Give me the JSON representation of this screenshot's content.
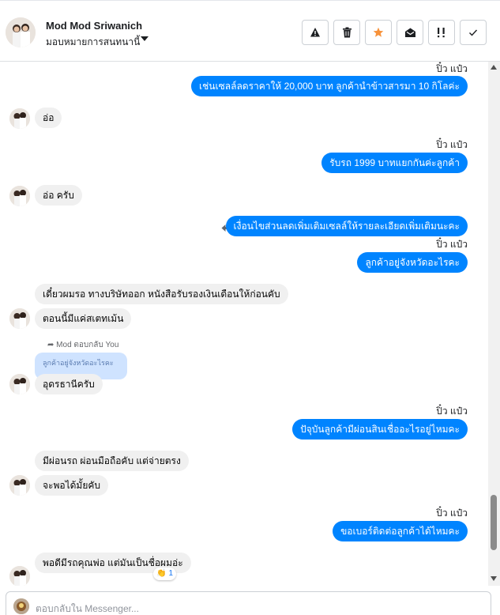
{
  "header": {
    "contact_name": "Mod Mod Sriwanich",
    "assign_label": "มอบหมายการสนทนานี้",
    "tools": [
      {
        "icon": "warning-icon"
      },
      {
        "icon": "trash-icon"
      },
      {
        "icon": "star-icon",
        "color": "#f7923a"
      },
      {
        "icon": "mark-unread-icon"
      },
      {
        "icon": "follow-up-icon"
      },
      {
        "icon": "check-icon"
      }
    ]
  },
  "messages": {
    "m1": {
      "sender": "ปิ๋ว แป๋ว",
      "text": "เช่นเซลล์ลดราคาให้ 20,000 บาท ลูกค้านำข้าวสารมา 10 กิโลค่ะ"
    },
    "m2": {
      "text": "อ่อ"
    },
    "m3": {
      "sender": "ปิ๋ว แป๋ว",
      "text": "รับรถ 1999 บาทแยกกันค่ะลูกค้า"
    },
    "m4": {
      "text": "อ่อ ครับ"
    },
    "m5": {
      "text": "เงื่อนไขส่วนลดเพิ่มเติมเซลล์ให้รายละเอียดเพิ่มเติมนะคะ"
    },
    "m6": {
      "sender": "ปิ๋ว แป๋ว",
      "text": "ลูกค้าอยู่จังหวัดอะไรคะ"
    },
    "m7": {
      "text": "เดี๋ยวผมรอ ทางบริษัทออก หนังสือรับรองเงินเดือนให้ก่อนคับ"
    },
    "m8": {
      "text": "ตอนนี้มีแค่สเตทเม้น"
    },
    "m9": {
      "reply_meta": "Mod ตอบกลับ You",
      "quoted": "ลูกค้าอยู่จังหวัดอะไรคะ",
      "text": "อุดรธานีครับ"
    },
    "m10": {
      "sender": "ปิ๋ว แป๋ว",
      "text": "ปัจุบันลูกค้ามีผ่อนสินเชื่ออะไรอยู่ไหมคะ"
    },
    "m11": {
      "text": "มีผ่อนรถ ผ่อนมือถือคับ แต่จ่ายตรง"
    },
    "m12": {
      "text": "จะพอได้มั้ยคับ"
    },
    "m13": {
      "sender": "ปิ๋ว แป๋ว",
      "text": "ขอเบอร์ติดต่อลูกค้าได้ไหมคะ"
    },
    "m14": {
      "text": "พอดีมีรถคุณพ่อ แต่มันเป็นชื่อผมอ่ะ",
      "reaction": {
        "emoji": "👏",
        "count": "1"
      }
    }
  },
  "composer": {
    "placeholder": "ตอบกลับใน Messenger..."
  },
  "colors": {
    "outgoing_bubble": "#0084ff",
    "incoming_bubble": "#f0f0f0",
    "quoted_bubble": "#cfe3ff"
  }
}
